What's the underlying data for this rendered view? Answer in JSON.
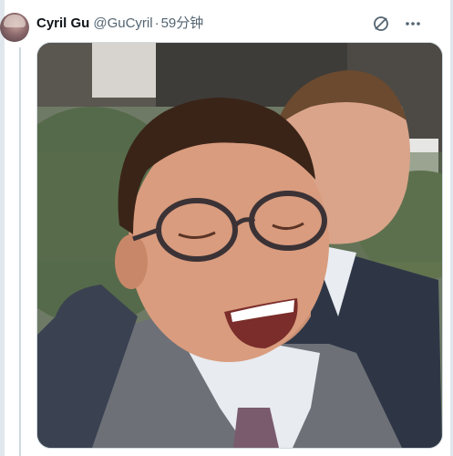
{
  "tweet": {
    "author_name": "Cyril Gu",
    "handle": "@GuCyril",
    "separator": "·",
    "time": "59分钟",
    "media": {
      "alt_icon": "photo-laughing-man"
    }
  },
  "icons": {
    "more": "more-dots-icon",
    "grok": "grok-icon"
  },
  "colors": {
    "text_primary": "#0f1419",
    "text_secondary": "#536471",
    "border": "#cfd9de"
  }
}
